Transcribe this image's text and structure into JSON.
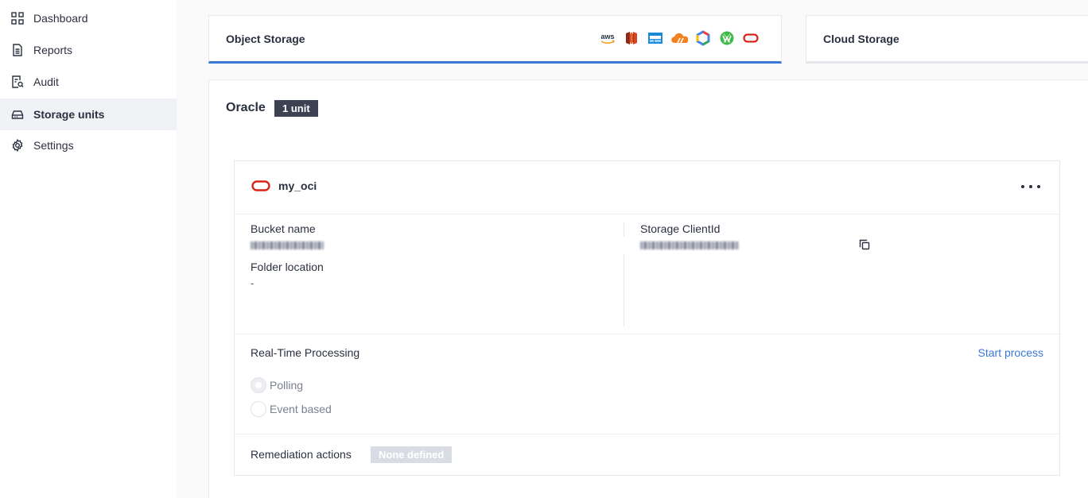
{
  "sidebar": {
    "items": [
      {
        "label": "Dashboard",
        "icon": "grid-icon",
        "active": false
      },
      {
        "label": "Reports",
        "icon": "document-icon",
        "active": false
      },
      {
        "label": "Audit",
        "icon": "audit-icon",
        "active": false
      },
      {
        "label": "Storage units",
        "icon": "storage-icon",
        "active": true
      },
      {
        "label": "Settings",
        "icon": "gear-icon",
        "active": false
      }
    ]
  },
  "tabs": {
    "object_storage": {
      "label": "Object Storage",
      "active": true
    },
    "cloud_storage": {
      "label": "Cloud Storage",
      "active": false
    },
    "providers": [
      {
        "name": "aws-icon",
        "text": "aws",
        "color": "#232f3e"
      },
      {
        "name": "aws-s3-icon",
        "color": "#b0341c"
      },
      {
        "name": "azure-blob-icon",
        "color": "#1e88d8"
      },
      {
        "name": "cloudflare-icon",
        "color": "#f48120"
      },
      {
        "name": "google-cloud-icon",
        "color": "#4285f4"
      },
      {
        "name": "wasabi-icon",
        "color": "#3fba4a"
      },
      {
        "name": "oracle-icon",
        "color": "#d9261c"
      }
    ]
  },
  "section": {
    "title": "Oracle",
    "badge": "1 unit"
  },
  "card": {
    "name": "my_oci",
    "logo_color": "#d9261c",
    "bucket_label": "Bucket name",
    "folder_label": "Folder location",
    "folder_value": "-",
    "client_label": "Storage ClientId",
    "realtime_label": "Real-Time Processing",
    "start_label": "Start process",
    "options": [
      {
        "label": "Polling",
        "checked": true
      },
      {
        "label": "Event based",
        "checked": false
      }
    ],
    "remediation_label": "Remediation actions",
    "remediation_value": "None defined"
  },
  "colors": {
    "accent": "#3a78d8",
    "badge_dark": "#3c4252",
    "badge_muted": "#d9dce2"
  }
}
